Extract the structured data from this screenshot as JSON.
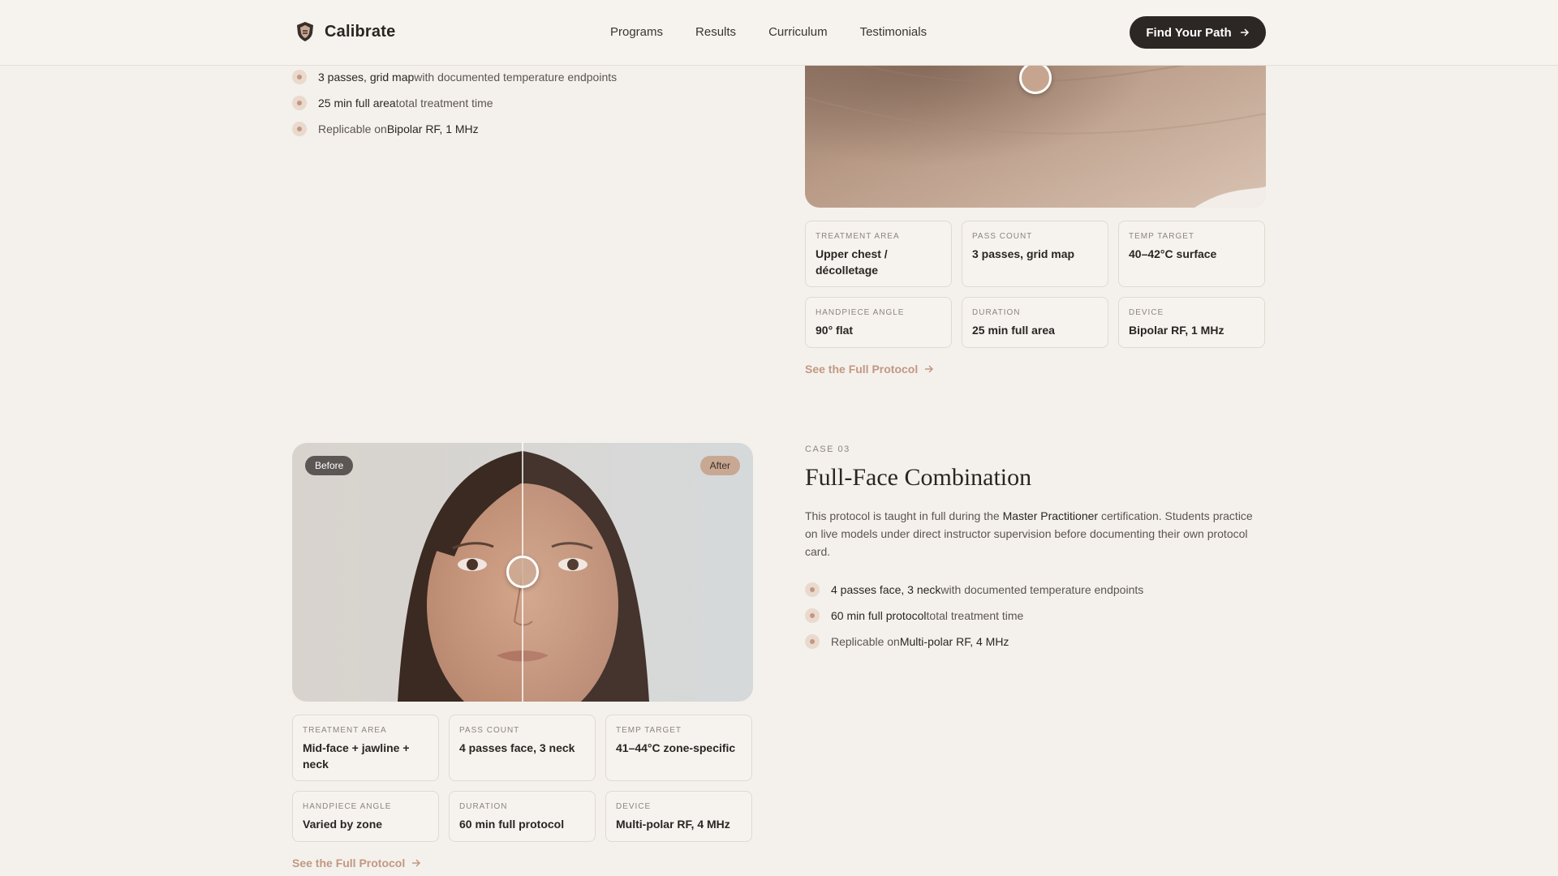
{
  "nav": {
    "brand": "Calibrate",
    "links": [
      "Programs",
      "Results",
      "Curriculum",
      "Testimonials"
    ],
    "cta": "Find Your Path"
  },
  "case02": {
    "bullets": [
      {
        "strong": "3 passes, grid map",
        "rest": " with documented temperature endpoints"
      },
      {
        "strong": "25 min full area",
        "rest": " total treatment time"
      },
      {
        "pre": "Replicable on ",
        "strong": "Bipolar RF, 1 MHz"
      }
    ],
    "stats": [
      {
        "label": "Treatment Area",
        "value": "Upper chest / décolletage"
      },
      {
        "label": "Pass Count",
        "value": "3 passes, grid map"
      },
      {
        "label": "Temp Target",
        "value": "40–42°C surface"
      },
      {
        "label": "Handpiece Angle",
        "value": "90° flat"
      },
      {
        "label": "Duration",
        "value": "25 min full area"
      },
      {
        "label": "Device",
        "value": "Bipolar RF, 1 MHz"
      }
    ],
    "link": "See the Full Protocol"
  },
  "case03": {
    "label": "CASE 03",
    "title": "Full-Face Combination",
    "desc_pre": "This protocol is taught in full during the ",
    "desc_hl": "Master Practitioner",
    "desc_post": " certification. Students practice on live models under direct instructor supervision before documenting their own protocol card.",
    "bullets": [
      {
        "strong": "4 passes face, 3 neck",
        "rest": " with documented temperature endpoints"
      },
      {
        "strong": "60 min full protocol",
        "rest": " total treatment time"
      },
      {
        "pre": "Replicable on ",
        "strong": "Multi-polar RF, 4 MHz"
      }
    ],
    "before_label": "Before",
    "after_label": "After",
    "stats": [
      {
        "label": "Treatment Area",
        "value": "Mid-face + jawline + neck"
      },
      {
        "label": "Pass Count",
        "value": "4 passes face, 3 neck"
      },
      {
        "label": "Temp Target",
        "value": "41–44°C zone-specific"
      },
      {
        "label": "Handpiece Angle",
        "value": "Varied by zone"
      },
      {
        "label": "Duration",
        "value": "60 min full protocol"
      },
      {
        "label": "Device",
        "value": "Multi-polar RF, 4 MHz"
      }
    ],
    "link": "See the Full Protocol"
  },
  "icons": {
    "logo": "shield-logo-icon",
    "arrow": "arrow-right-icon",
    "bullet": "dot-icon"
  }
}
